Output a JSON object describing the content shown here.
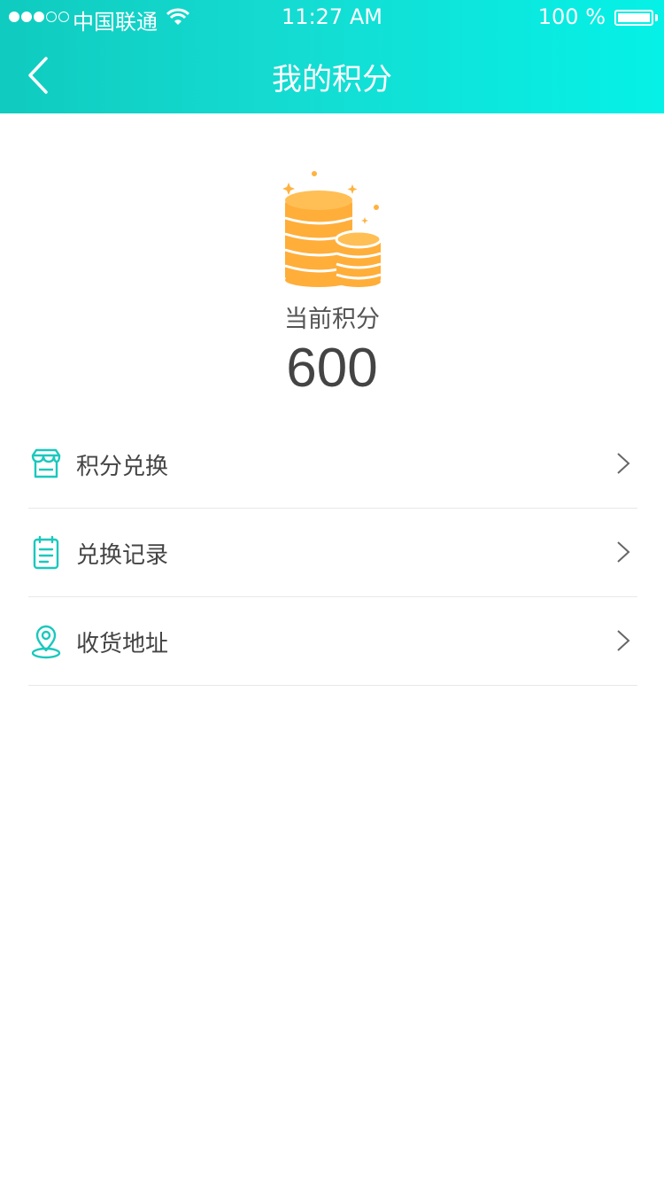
{
  "status_bar": {
    "carrier": "中国联通",
    "time": "11:27 AM",
    "battery": "100 %"
  },
  "nav": {
    "title": "我的积分",
    "back_icon": "chevron-left-icon"
  },
  "points": {
    "label": "当前积分",
    "value": "600",
    "icon": "coins-icon"
  },
  "menu": {
    "items": [
      {
        "label": "积分兑换",
        "icon": "store-icon"
      },
      {
        "label": "兑换记录",
        "icon": "clipboard-icon"
      },
      {
        "label": "收货地址",
        "icon": "location-pin-icon"
      }
    ]
  },
  "colors": {
    "header_gradient_start": "#10cbbf",
    "header_gradient_end": "#05f1e7",
    "accent": "#1ac8bd",
    "coin": "#ffb23f"
  }
}
